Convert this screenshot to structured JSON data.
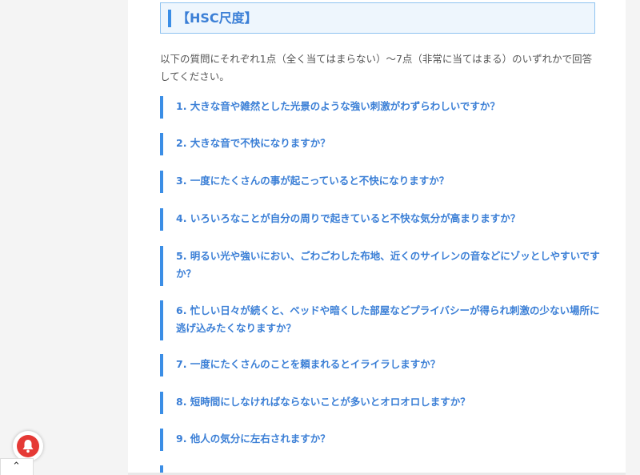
{
  "section": {
    "title": "【HSC尺度】"
  },
  "intro": "以下の質問にそれぞれ1点（全く当てはまらない）〜7点（非常に当てはまる）のいずれかで回答してください。",
  "questions": [
    "1. 大きな音や雑然とした光景のような強い刺激がわずらわしいですか？",
    "2. 大きな音で不快になりますか？",
    "3. 一度にたくさんの事が起こっていると不快になりますか？",
    "4. いろいろなことが自分の周りで起きていると不快な気分が高まりますか？",
    "5. 明るい光や強いにおい、ごわごわした布地、近くのサイレンの音などにゾッとしやすいですか？",
    "6. 忙しい日々が続くと、ベッドや暗くした部屋などプライバシーが得られ刺激の少ない場所に逃げ込みたくなりますか？",
    "7. 一度にたくさんのことを頼まれるとイライラしますか？",
    "8. 短時間にしなければならないことが多いとオロオロしますか？",
    "9. 他人の気分に左右されますか？"
  ],
  "icons": {
    "bell": "bell-icon",
    "chevron": "chevron-up-icon"
  },
  "colors": {
    "accent": "#3b8ee6",
    "question_text": "#3b7fd6",
    "notification": "#e53935"
  }
}
